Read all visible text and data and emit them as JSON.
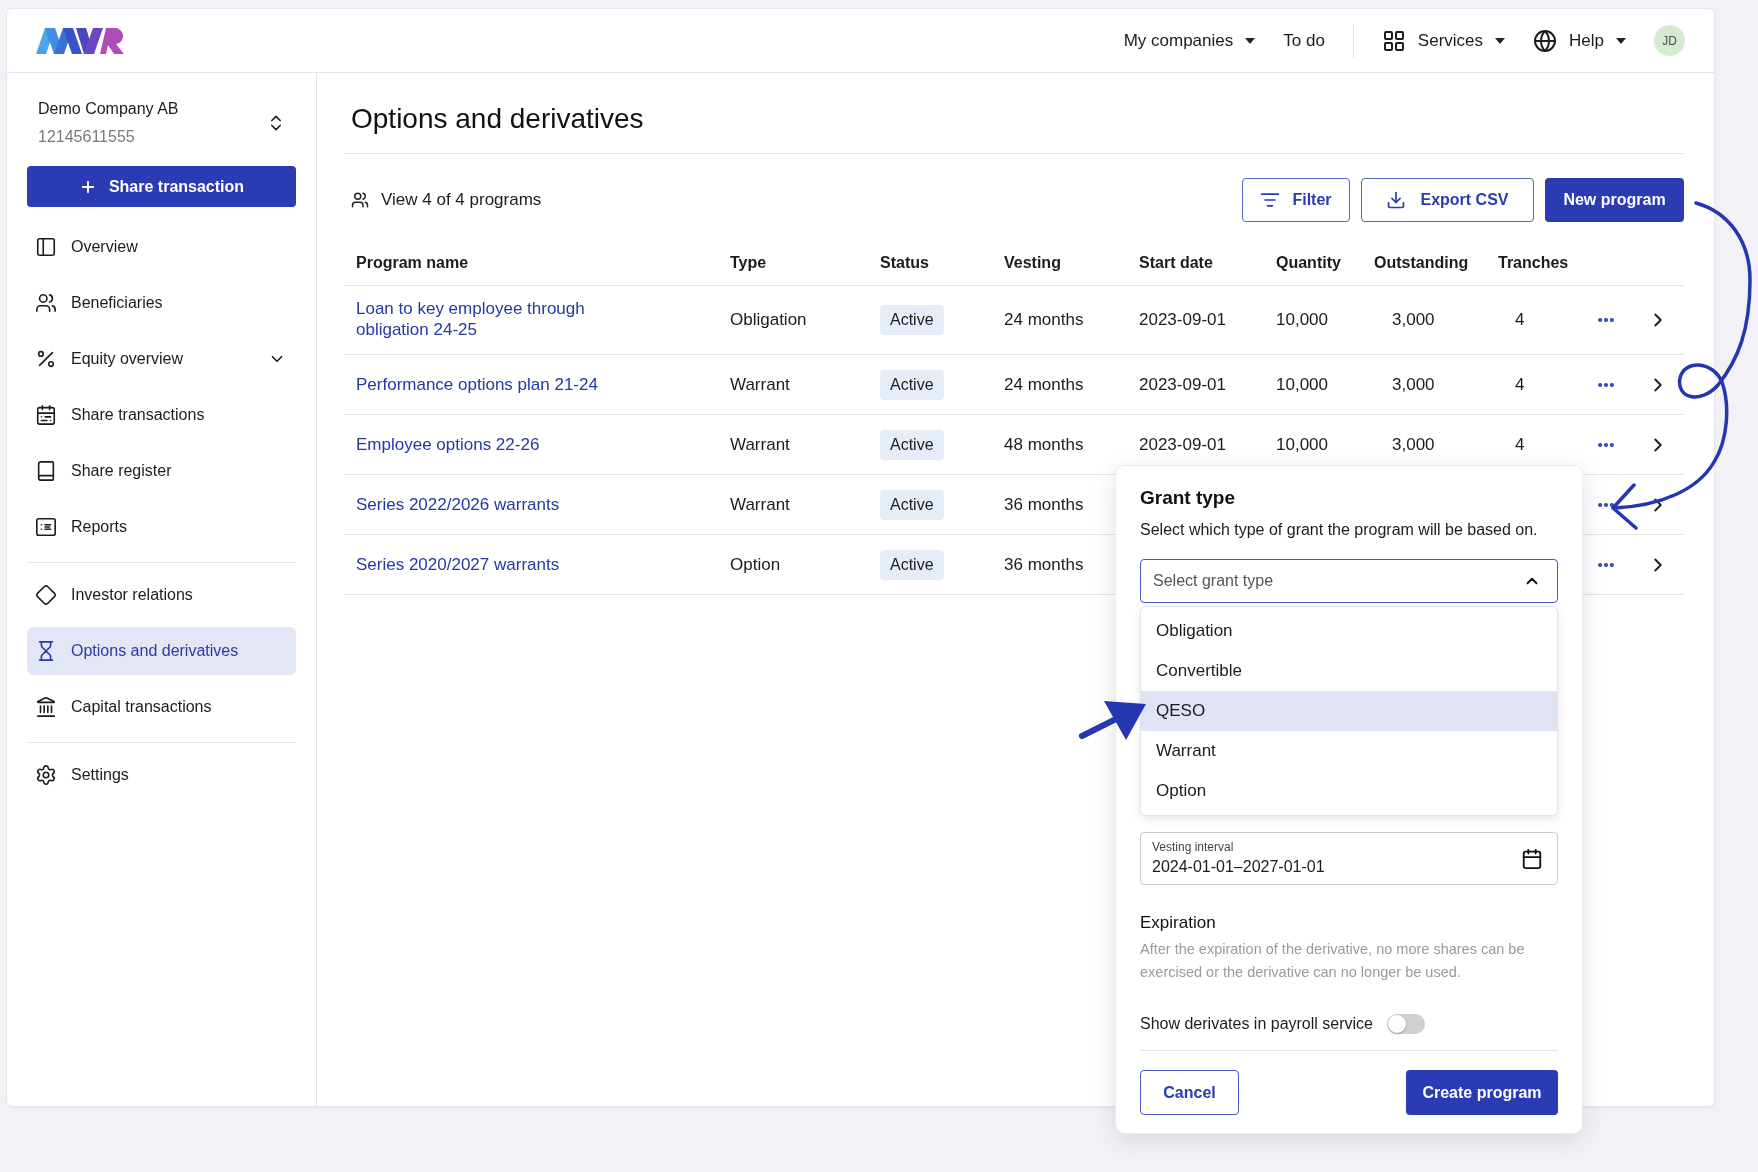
{
  "header": {
    "nav": [
      {
        "label": "My companies",
        "dropdown": true
      },
      {
        "label": "To do",
        "dropdown": false
      },
      {
        "label": "Services",
        "dropdown": true
      },
      {
        "label": "Help",
        "dropdown": true
      }
    ],
    "avatar": "JD"
  },
  "sidebar": {
    "company_name": "Demo Company AB",
    "company_number": "12145611555",
    "action_button": "Share transaction",
    "sections": [
      [
        {
          "label": "Overview",
          "selected": false
        },
        {
          "label": "Beneficiaries",
          "selected": false
        },
        {
          "label": "Equity overview",
          "selected": false,
          "expanded": false
        },
        {
          "label": "Share transactions",
          "selected": false
        },
        {
          "label": "Share register",
          "selected": false
        },
        {
          "label": "Reports",
          "selected": false
        }
      ],
      [
        {
          "label": "Investor relations",
          "selected": false
        },
        {
          "label": "Options and derivatives",
          "selected": true
        },
        {
          "label": "Capital transactions",
          "selected": false
        }
      ],
      [
        {
          "label": "Settings",
          "selected": false
        }
      ]
    ]
  },
  "page": {
    "title": "Options and derivatives",
    "summary": "View 4 of 4 programs",
    "buttons": [
      {
        "label": "Filter",
        "kind": "filter"
      },
      {
        "label": "Export CSV",
        "kind": "export"
      },
      {
        "label": "New program",
        "kind": "primary"
      }
    ]
  },
  "table": {
    "columns": [
      "Program name",
      "Type",
      "Status",
      "Vesting",
      "Start date",
      "Quantity",
      "Outstanding",
      "Tranches"
    ],
    "rows": [
      {
        "cells": [
          "Loan to key employee through obligation 24-25",
          "Obligation",
          "Active",
          "24 months",
          "2023-09-01",
          "10,000",
          "3,000",
          "4"
        ]
      },
      {
        "cells": [
          "Performance options plan 21-24",
          "Warrant",
          "Active",
          "24 months",
          "2023-09-01",
          "10,000",
          "3,000",
          "4"
        ]
      },
      {
        "cells": [
          "Employee options 22-26",
          "Warrant",
          "Active",
          "48 months",
          "2023-09-01",
          "10,000",
          "3,000",
          "4"
        ]
      },
      {
        "cells": [
          "Series 2022/2026 warrants",
          "Warrant",
          "Active",
          "36 months"
        ]
      },
      {
        "cells": [
          "Series 2020/2027 warrants",
          "Option",
          "Active",
          "36 months"
        ]
      }
    ]
  },
  "grant_dialog": {
    "title": "Grant type",
    "description": "Select which type of grant the program will be based on.",
    "select": {
      "placeholder": "Select grant type",
      "expanded": true
    },
    "options": [
      {
        "label": "Obligation",
        "selected": false
      },
      {
        "label": "Convertible",
        "selected": false
      },
      {
        "label": "QESO",
        "selected": true
      },
      {
        "label": "Warrant",
        "selected": false
      },
      {
        "label": "Option",
        "selected": false
      }
    ],
    "vesting_interval": {
      "label": "Vesting interval",
      "value": "2024-01-01–2027-01-01"
    },
    "expiration": {
      "title": "Expiration",
      "description": "After the expiration of the derivative, no more shares can be exercised or the derivative can no longer be used."
    },
    "payroll_toggle": {
      "label": "Show derivates in payroll service",
      "on": false
    },
    "buttons": [
      {
        "label": "Cancel",
        "kind": "secondary"
      },
      {
        "label": "Create program",
        "kind": "primary"
      }
    ]
  }
}
